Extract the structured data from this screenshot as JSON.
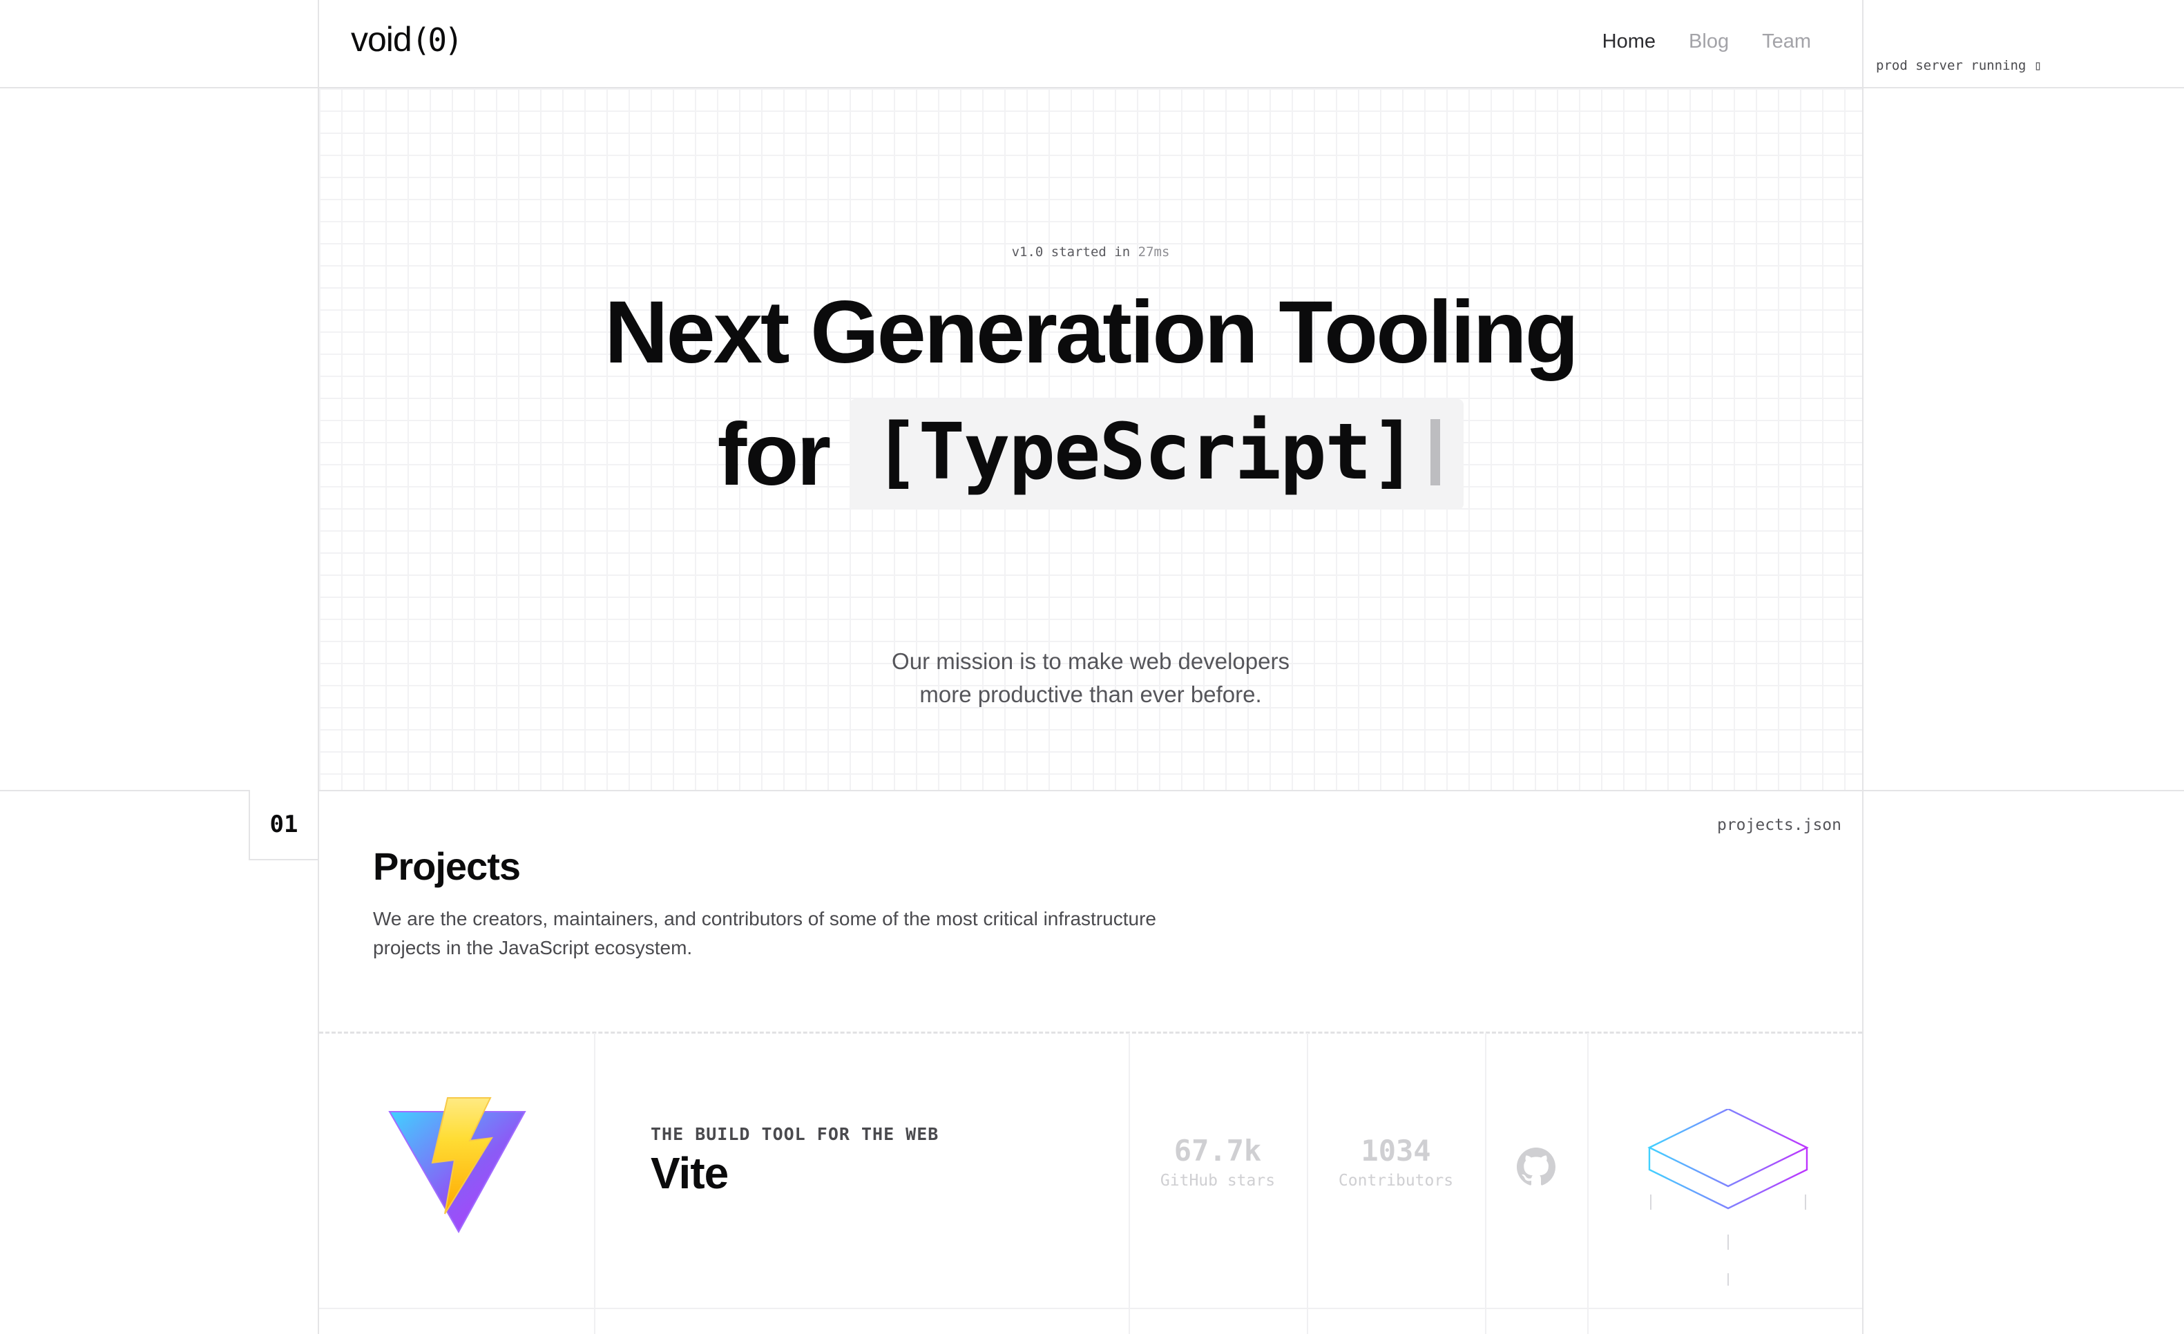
{
  "header": {
    "logo": {
      "word": "void",
      "mark": "(0)"
    },
    "nav": [
      {
        "label": "Home",
        "active": true
      },
      {
        "label": "Blog",
        "active": false
      },
      {
        "label": "Team",
        "active": false
      }
    ],
    "status": "prod server running ▯"
  },
  "hero": {
    "version_prefix": "v1.0 started in",
    "version_ms": "27ms",
    "title_line1": "Next Generation Tooling",
    "title_for": "for",
    "title_language": "[TypeScript]",
    "mission_line1": "Our mission is to make web developers",
    "mission_line2": "more productive than ever before."
  },
  "projects": {
    "section_number": "01",
    "file_label": "projects.json",
    "title": "Projects",
    "description_line1": "We are the creators, maintainers, and contributors of some of the most critical infrastructure",
    "description_line2": "projects in the JavaScript ecosystem.",
    "items": [
      {
        "tagline": "THE BUILD TOOL FOR THE WEB",
        "name": "Vite",
        "stars_value": "67.7k",
        "stars_label": "GitHub stars",
        "contributors_value": "1034",
        "contributors_label": "Contributors",
        "logo_icon": "vite-logo-icon",
        "repo_icon": "github-icon",
        "illustration": "isometric-box-icon"
      }
    ]
  },
  "colors": {
    "text": "#0b0b0c",
    "muted": "#55555a",
    "nav_inactive": "#a3a3a8",
    "frame_line": "#e4e4e6",
    "stat_faded": "#cfcfd2",
    "code_bg": "#f3f3f4"
  }
}
